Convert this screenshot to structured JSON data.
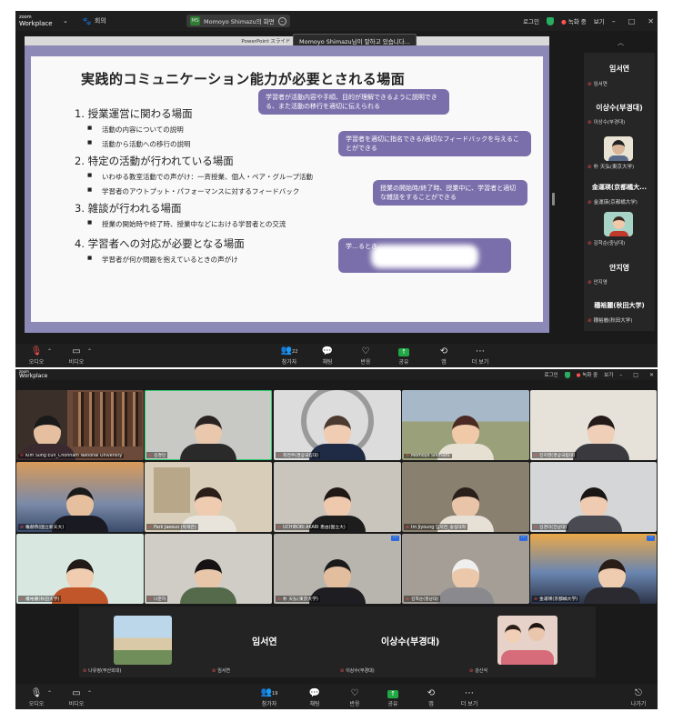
{
  "window1": {
    "logo": {
      "line1": "zoom",
      "line2": "Workplace"
    },
    "room_label": "회의",
    "share_pill": {
      "initials": "MS",
      "text": "Momoyo Shimazu의 화면"
    },
    "tooltip": "Momoyo Shimazu님이 말하고 있습니다...",
    "ppt_bar": "PowerPoint スライド ショー - [Worksh",
    "topbar_right": {
      "login": "로그인",
      "recording": "녹화 중",
      "view": "보기"
    },
    "slide": {
      "title": "実践的コミュニケーション能力が必要とされる場面",
      "sections": [
        {
          "heading": "1.  授業運営に関わる場面",
          "items": [
            "活動の内容についての説明",
            "活動から活動への移行の説明"
          ]
        },
        {
          "heading": "2.  特定の活動が行われている場面",
          "items": [
            "いわゆる教室活動での声がけ：一斉授業、個人・ペア・グループ活動",
            "学習者のアウトプット・パフォーマンスに対するフィードバック"
          ]
        },
        {
          "heading": "3.  雑談が行われる場面",
          "items": [
            "授業の開始時や終了時、授業中などにおける学習者との交流"
          ]
        },
        {
          "heading": "4.  学習者への対応が必要となる場面",
          "items": [
            "学習者が何か問題を抱えているときの声がけ"
          ]
        }
      ],
      "bubbles": [
        "学習者が活動内容や手順、目的が理解できるように説明できる、また活動の移行を適切に伝えられる",
        "学習者を適切に指名できる/適切なフィードバックを与えることができる",
        "授業の開始時/終了時、授業中に、学習者と適切な雑談をすることができる",
        "学…るとき、"
      ]
    },
    "sidebar": [
      {
        "name": "임서연",
        "label": "임서연"
      },
      {
        "name": "이상수(부경대)",
        "label": "이상수(부경대)"
      },
      {
        "name": "",
        "label": "朴 天弘(東京大学)"
      },
      {
        "name": "金運瑛(京都橘大...",
        "label": "金運瑛(京都橘大学)"
      },
      {
        "name": "",
        "label": "김학순(중남대)"
      },
      {
        "name": "안지영",
        "label": "안지영"
      },
      {
        "name": "穗裕麗(秋田大学)",
        "label": "穗裕麗(秋田大学)"
      }
    ],
    "controls": {
      "audio": "오디오",
      "video": "비디오",
      "participants": "참가자",
      "participants_count": "22",
      "chat": "채팅",
      "react": "반응",
      "share": "공유",
      "apps": "앱",
      "more": "더 보기"
    }
  },
  "window2": {
    "logo": {
      "line1": "zoom",
      "line2": "Workplace"
    },
    "topbar_right": {
      "login": "로그인",
      "recording": "녹화 중",
      "view": "보기"
    },
    "tiles": [
      {
        "label": "Kim Sung Eun_Chonnam National University"
      },
      {
        "label": "김경민"
      },
      {
        "label": "최연주(경상국립대)"
      },
      {
        "label": "Momoyo Shimazu"
      },
      {
        "label": "진지영(경상국립대)"
      },
      {
        "label": "権赫燕(国立新天大)"
      },
      {
        "label": "Park Jaeeun (박재은)"
      },
      {
        "label": "UCHIBORI AKARI 恵由(国立大)"
      },
      {
        "label": "Im Jiyoung 임지연_숭실대학"
      },
      {
        "label": "김경미(전남대)"
      },
      {
        "label": "權裕麗(秋田大学)"
      },
      {
        "label": "나준하"
      },
      {
        "label": "朴 天弘(東京大学)"
      },
      {
        "label": "김학순(충남대)"
      },
      {
        "label": "金運瑛(京都橘大学)"
      }
    ],
    "bottom": {
      "names": [
        "임서연",
        "이상수(부경대)"
      ],
      "labels": [
        "나유정(부산외대)",
        "임서연",
        "이상수(부경대)",
        "강신석"
      ]
    },
    "controls": {
      "audio": "오디오",
      "video": "비디오",
      "participants": "참가자",
      "participants_count": "19",
      "chat": "채팅",
      "react": "반응",
      "share": "공유",
      "apps": "앱",
      "more": "더 보기",
      "leave": "나가기"
    }
  }
}
